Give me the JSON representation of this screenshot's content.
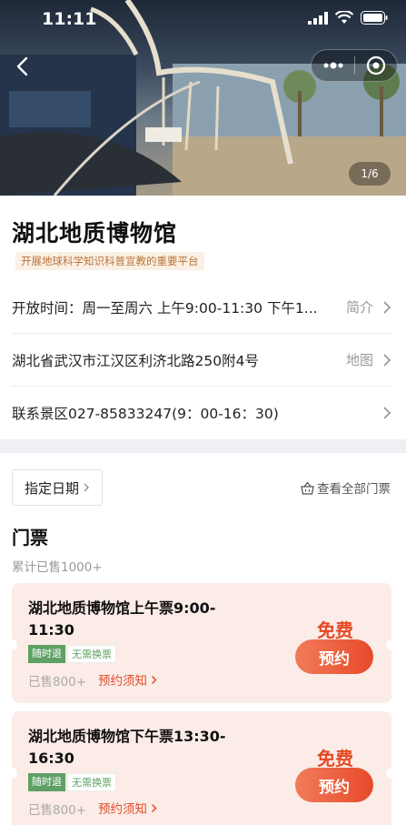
{
  "status_bar": {
    "time": "11:11"
  },
  "hero": {
    "page_indicator": "1/6"
  },
  "venue": {
    "name": "湖北地质博物馆",
    "tag": "开展地球科学知识科普宣教的重要平台",
    "hours": "开放时间：周一至周六 上午9:00-11:30 下午1...",
    "hours_action": "简介",
    "address": "湖北省武汉市江汉区利济北路250附4号",
    "address_action": "地图",
    "contact": "联系景区027-85833247(9：00-16：30)"
  },
  "tickets_section": {
    "date_button": "指定日期",
    "all_tickets": "查看全部门票",
    "title": "门票",
    "total_sold": "累计已售1000+",
    "items": [
      {
        "name": "湖北地质博物馆上午票9:00-11:30",
        "badges": [
          "随时退",
          "无需换票"
        ],
        "sold": "已售800+",
        "notice": "预约须知",
        "price": "免费",
        "book_label": "预约"
      },
      {
        "name": "湖北地质博物馆下午票13:30-16:30",
        "badges": [
          "随时退",
          "无需换票"
        ],
        "sold": "已售800+",
        "notice": "预约须知",
        "price": "免费",
        "book_label": "预约"
      }
    ]
  },
  "colors": {
    "accent": "#e64a24",
    "badge_green": "#5fa064",
    "tag_bg": "#fbf0e4",
    "ticket_bg": "#fbece7"
  }
}
